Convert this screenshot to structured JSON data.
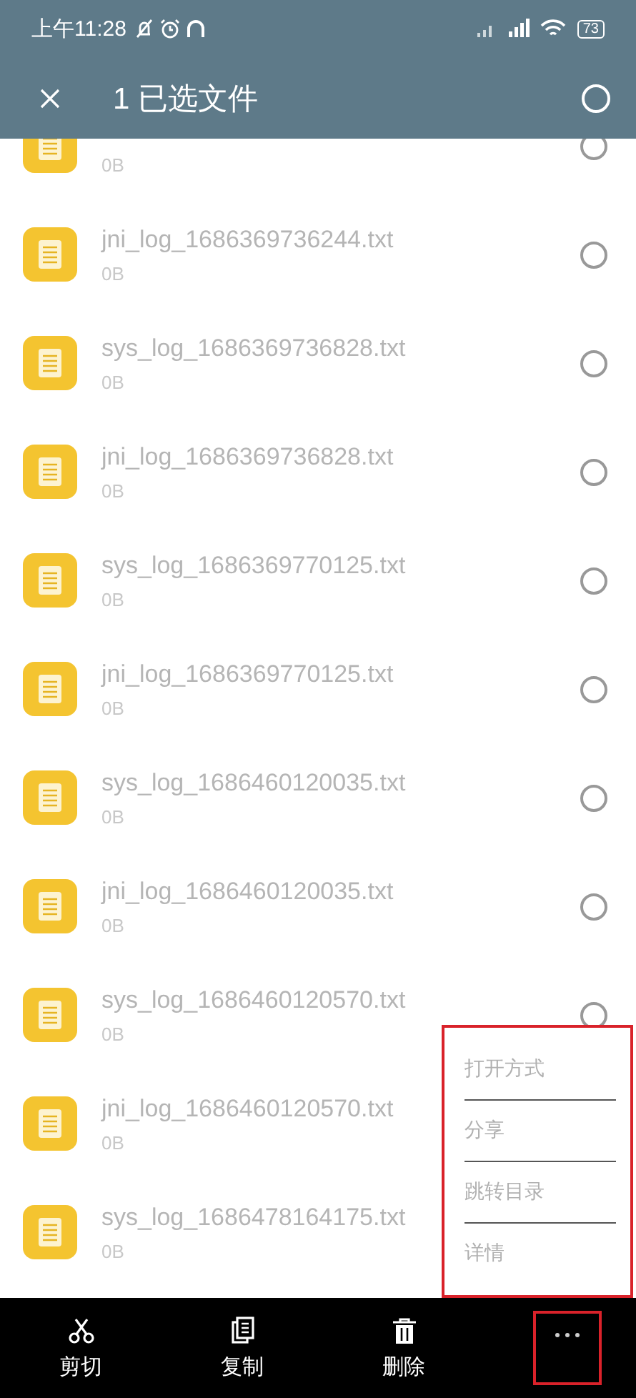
{
  "status_bar": {
    "time": "上午11:28",
    "battery": "73"
  },
  "app_bar": {
    "title": "1 已选文件",
    "select_all": false
  },
  "files": [
    {
      "size": "0B",
      "selected": false
    },
    {
      "name": "jni_log_1686369736244.txt",
      "size": "0B",
      "selected": false
    },
    {
      "name": "sys_log_1686369736828.txt",
      "size": "0B",
      "selected": false
    },
    {
      "name": "jni_log_1686369736828.txt",
      "size": "0B",
      "selected": false
    },
    {
      "name": "sys_log_1686369770125.txt",
      "size": "0B",
      "selected": false
    },
    {
      "name": "jni_log_1686369770125.txt",
      "size": "0B",
      "selected": false
    },
    {
      "name": "sys_log_1686460120035.txt",
      "size": "0B",
      "selected": false
    },
    {
      "name": "jni_log_1686460120035.txt",
      "size": "0B",
      "selected": false
    },
    {
      "name": "sys_log_1686460120570.txt",
      "size": "0B",
      "selected": false
    },
    {
      "name": "jni_log_1686460120570.txt",
      "size": "0B"
    },
    {
      "name": "sys_log_1686478164175.txt",
      "size": "0B"
    }
  ],
  "popup_menu": [
    "打开方式",
    "分享",
    "跳转目录",
    "详情"
  ],
  "bottom_bar": [
    {
      "kind": "cut",
      "label": "剪切"
    },
    {
      "kind": "copy",
      "label": "复制"
    },
    {
      "kind": "delete",
      "label": "删除"
    },
    {
      "kind": "more"
    }
  ]
}
